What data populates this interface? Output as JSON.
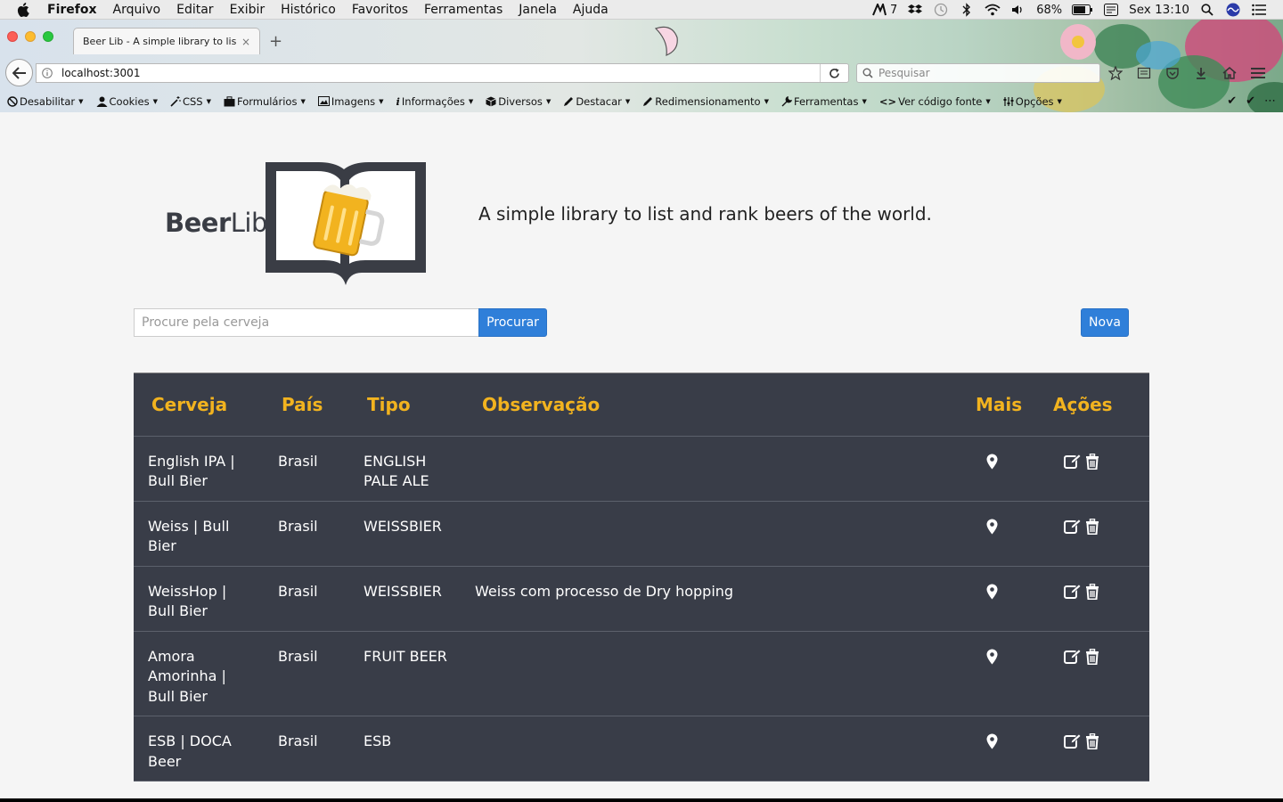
{
  "menubar": {
    "apple_icon": "apple-logo-icon",
    "app_name": "Firefox",
    "items": [
      "Arquivo",
      "Editar",
      "Exibir",
      "Histórico",
      "Favoritos",
      "Ferramentas",
      "Janela",
      "Ajuda"
    ],
    "status": {
      "notifications_count": "7",
      "battery": "68%",
      "clock": "Sex 13:10"
    }
  },
  "browser": {
    "tab": {
      "title": "Beer Lib - A simple library to lis...",
      "close_glyph": "×"
    },
    "new_tab_glyph": "+",
    "url": "localhost:3001",
    "search_placeholder": "Pesquisar",
    "devbar": [
      {
        "label": "Desabilitar",
        "icon": "disable-icon"
      },
      {
        "label": "Cookies",
        "icon": "user-icon"
      },
      {
        "label": "CSS",
        "icon": "magic-wand-icon"
      },
      {
        "label": "Formulários",
        "icon": "briefcase-icon"
      },
      {
        "label": "Imagens",
        "icon": "image-icon"
      },
      {
        "label": "Informações",
        "icon": "info-icon"
      },
      {
        "label": "Diversos",
        "icon": "cube-icon"
      },
      {
        "label": "Destacar",
        "icon": "pencil-icon"
      },
      {
        "label": "Redimensionamento",
        "icon": "resize-icon"
      },
      {
        "label": "Ferramentas",
        "icon": "wrench-icon"
      },
      {
        "label": "Ver código fonte",
        "icon": "code-icon"
      },
      {
        "label": "Opções",
        "icon": "options-icon"
      }
    ]
  },
  "app": {
    "logo": {
      "bold": "Beer",
      "light": "Lib"
    },
    "tagline": "A simple library to list and rank beers of the world.",
    "search": {
      "placeholder": "Procure pela cerveja",
      "button": "Procurar"
    },
    "new_button": "Nova",
    "table": {
      "headers": [
        "Cerveja",
        "País",
        "Tipo",
        "Observação",
        "Mais",
        "Ações"
      ],
      "rows": [
        {
          "name": "English IPA | Bull Bier",
          "country": "Brasil",
          "type": "ENGLISH PALE ALE",
          "obs": ""
        },
        {
          "name": "Weiss | Bull Bier",
          "country": "Brasil",
          "type": "WEISSBIER",
          "obs": ""
        },
        {
          "name": "WeissHop | Bull Bier",
          "country": "Brasil",
          "type": "WEISSBIER",
          "obs": "Weiss com processo de Dry hopping"
        },
        {
          "name": "Amora Amorinha | Bull Bier",
          "country": "Brasil",
          "type": "FRUIT BEER",
          "obs": ""
        },
        {
          "name": "ESB | DOCA Beer",
          "country": "Brasil",
          "type": "ESB",
          "obs": ""
        }
      ]
    },
    "colors": {
      "header_text": "#f2b31f",
      "table_bg": "#393d48",
      "button_blue": "#2f7fd9"
    }
  }
}
